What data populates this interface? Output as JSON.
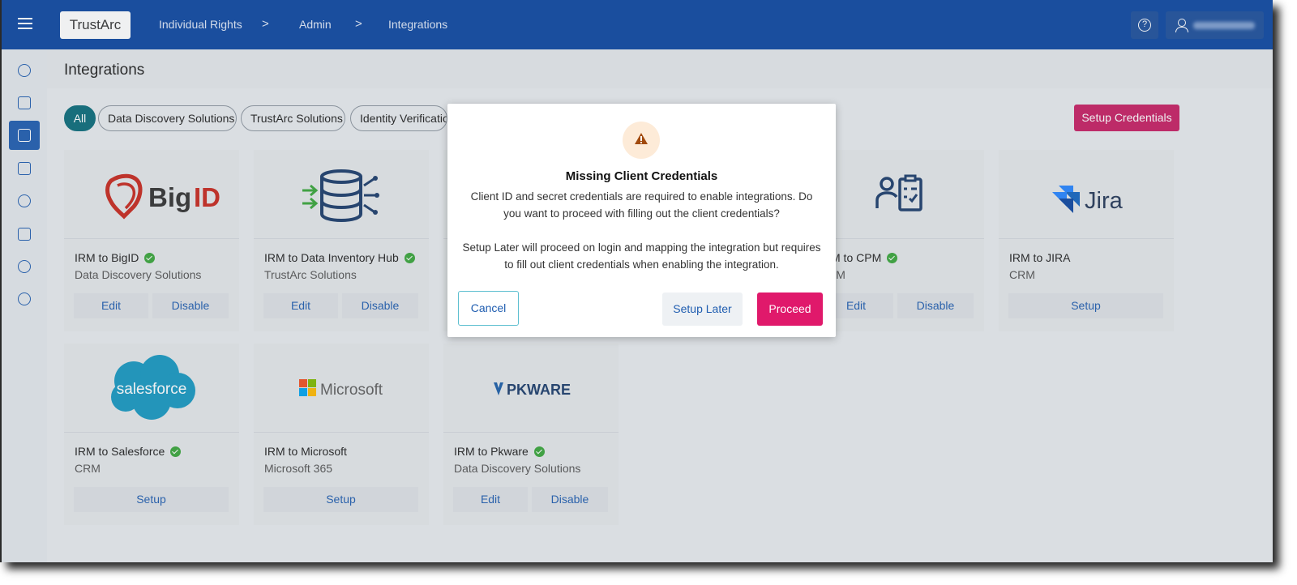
{
  "header": {
    "logo_text": "TrustArc",
    "breadcrumbs": [
      "Individual Rights",
      "Admin",
      "Integrations"
    ],
    "separator": ">"
  },
  "page": {
    "title": "Integrations"
  },
  "filters": {
    "chips": [
      "All",
      "Data Discovery Solutions",
      "TrustArc Solutions",
      "Identity Verificatio"
    ],
    "setup_credentials": "Setup Credentials"
  },
  "cards": [
    {
      "brand": "BigID",
      "title": "IRM to BigID",
      "subtitle": "Data Discovery Solutions",
      "btn1": "Edit",
      "btn2": "Disable"
    },
    {
      "brand": "data-inventory",
      "title": "IRM to Data Inventory Hub",
      "subtitle": "TrustArc Solutions",
      "btn1": "Edit",
      "btn2": "Disable"
    },
    {
      "brand": "cpm",
      "title": "IRM to CPM",
      "subtitle": "CRM",
      "btn1": "Edit",
      "btn2": "Disable"
    },
    {
      "brand": "Jira",
      "title": "IRM to JIRA",
      "subtitle": "CRM",
      "btn1": "Setup"
    },
    {
      "brand": "salesforce",
      "title": "IRM to Salesforce",
      "subtitle": "CRM",
      "btn1": "Setup"
    },
    {
      "brand": "Microsoft",
      "title": "IRM to Microsoft",
      "subtitle": "Microsoft 365",
      "btn1": "Setup"
    },
    {
      "brand": "PKWARE",
      "title": "IRM to Pkware",
      "subtitle": "Data Discovery Solutions",
      "btn1": "Edit",
      "btn2": "Disable"
    }
  ],
  "modal": {
    "title": "Missing Client Credentials",
    "paragraph1": "Client ID and secret credentials are required to enable integrations. Do you want to proceed with filling out the client credentials?",
    "paragraph2": "Setup Later will proceed on login and mapping the integration but requires to fill out client credentials when enabling the integration.",
    "cancel": "Cancel",
    "setup_later": "Setup Later",
    "proceed": "Proceed"
  },
  "colors": {
    "header_bg": "#0d47a1",
    "accent_pink": "#e0196b",
    "success_green": "#39a53b",
    "link_blue": "#1f5db0",
    "chip_active": "#0b6b7a"
  }
}
